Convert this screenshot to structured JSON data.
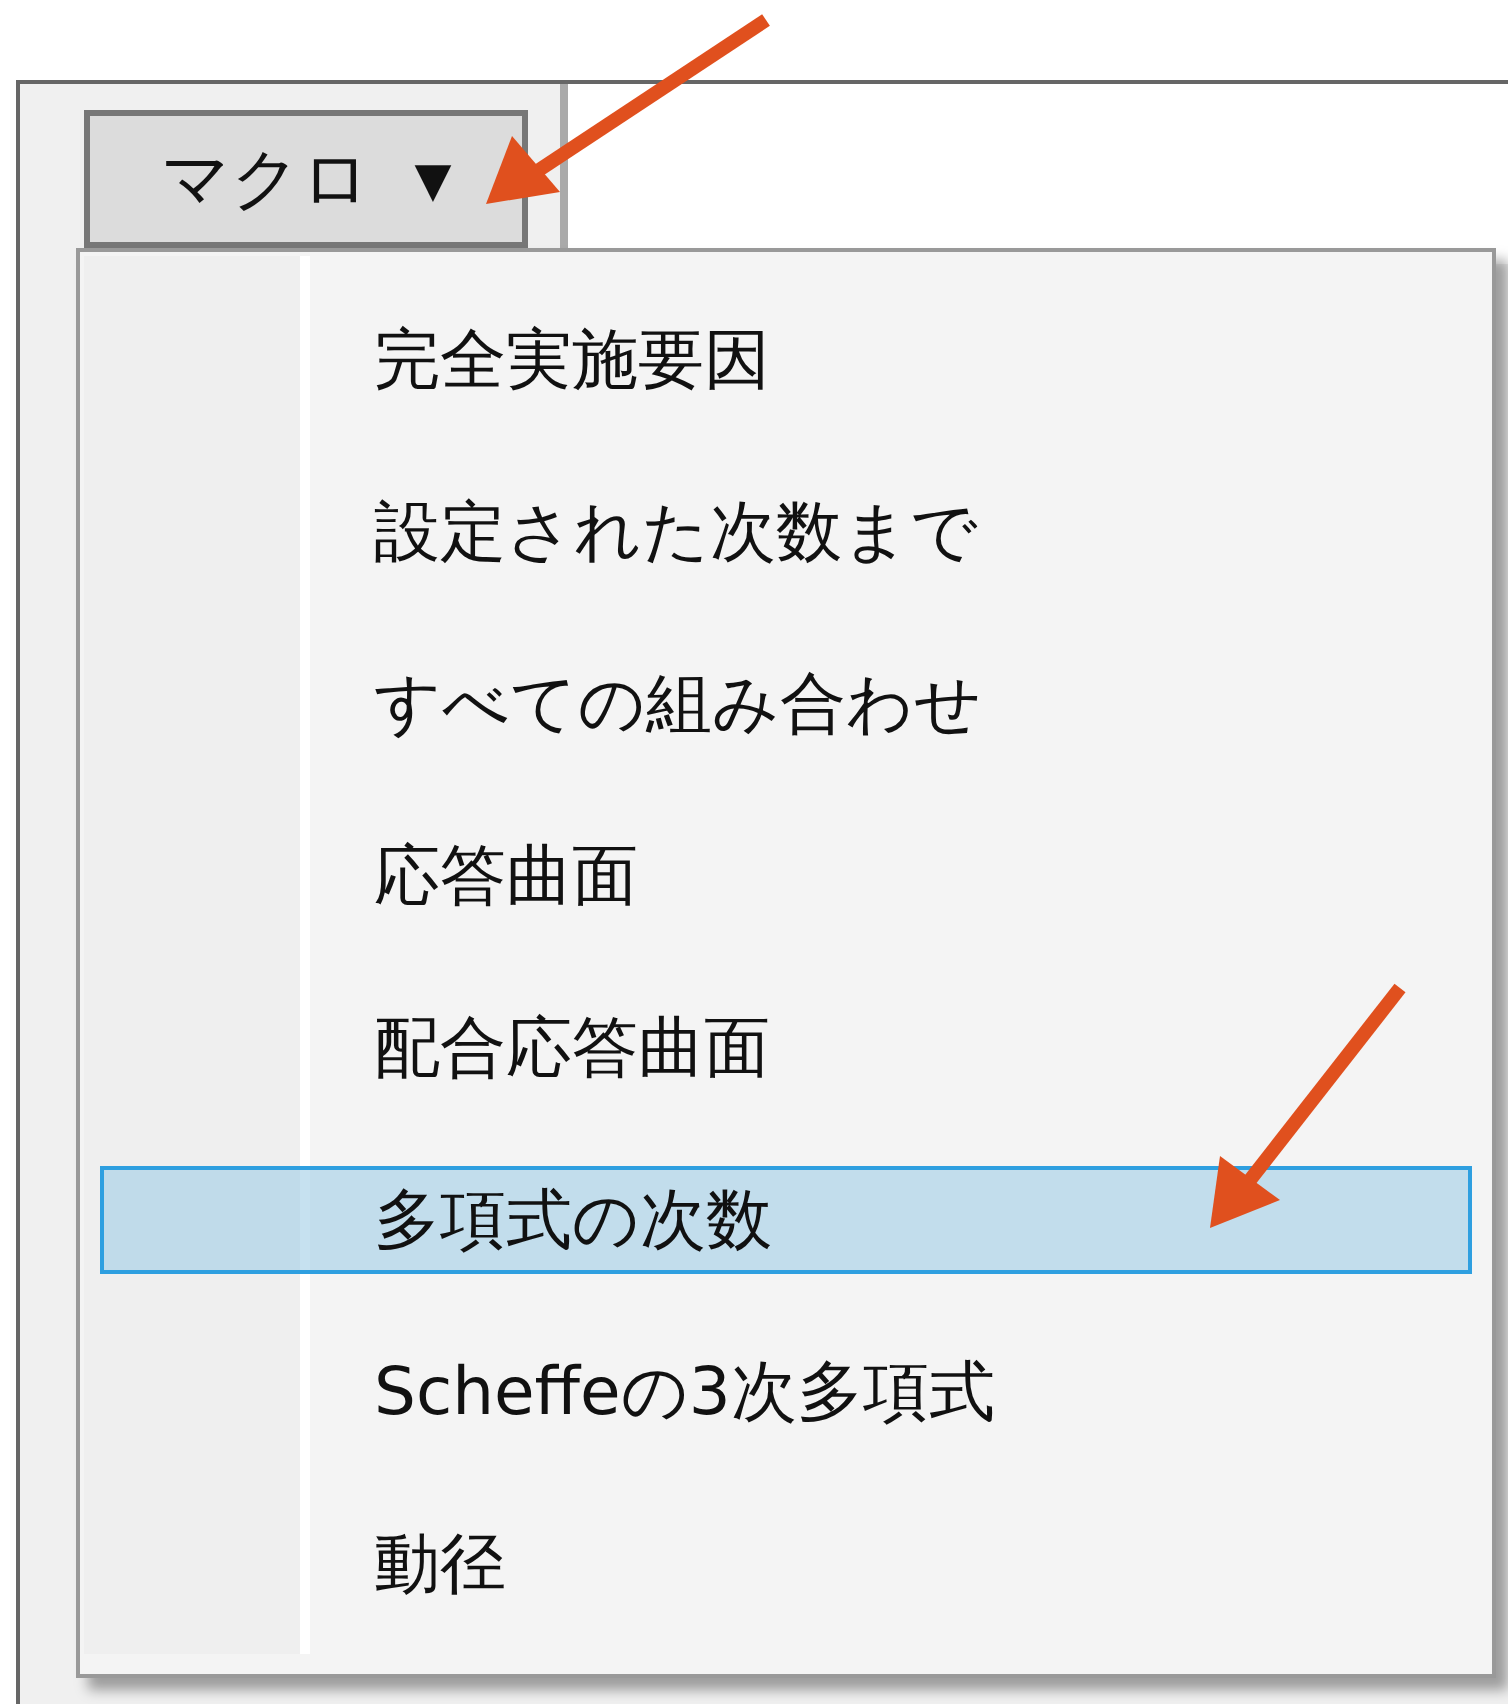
{
  "button": {
    "label": "マクロ",
    "caret": "▼"
  },
  "menu": {
    "items": [
      {
        "label": "完全実施要因",
        "selected": false
      },
      {
        "label": "設定された次数まで",
        "selected": false
      },
      {
        "label": "すべての組み合わせ",
        "selected": false
      },
      {
        "label": "応答曲面",
        "selected": false
      },
      {
        "label": "配合応答曲面",
        "selected": false
      },
      {
        "label": "多項式の次数",
        "selected": true
      },
      {
        "label": "Scheffeの3次多項式",
        "selected": false
      },
      {
        "label": "動径",
        "selected": false
      }
    ]
  }
}
